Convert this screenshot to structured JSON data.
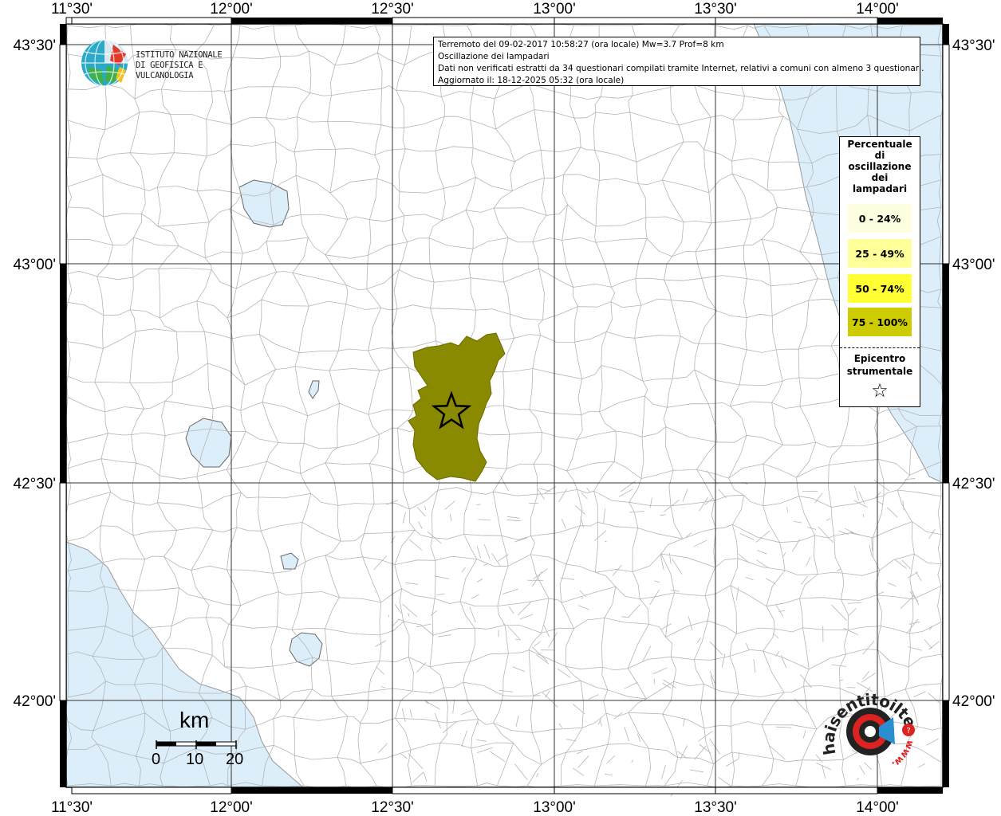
{
  "info": {
    "line1": "Terremoto del 09-02-2017 10:58:27 (ora locale) Mw=3.7 Prof=8 km",
    "line2": "Oscillazione dei lampadari",
    "line3": "Dati non verificati estratti da 34 questionari compilati tramite Internet, relativi a comuni con almeno 3 questionari.",
    "line4": "Aggiornato il: 18-12-2025 05:32 (ora locale)"
  },
  "axes": {
    "longitude_labels": [
      "11°30'",
      "12°00'",
      "12°30'",
      "13°00'",
      "13°30'",
      "14°00'"
    ],
    "latitude_labels": [
      "43°30'",
      "43°00'",
      "42°30'",
      "42°00'"
    ]
  },
  "legend": {
    "title_lines": [
      "Percentuale",
      "di",
      "oscillazione",
      "dei",
      "lampadari"
    ],
    "classes": [
      {
        "label": "0 - 24%",
        "color": "#fefee0"
      },
      {
        "label": "25 - 49%",
        "color": "#ffff99"
      },
      {
        "label": "50 - 74%",
        "color": "#ffff33"
      },
      {
        "label": "75 - 100%",
        "color": "#cccc00"
      }
    ],
    "epicenter_label_lines": [
      "Epicentro",
      "strumentale"
    ],
    "epicenter_symbol": "☆"
  },
  "logos": {
    "ingv_lines": [
      "ISTITUTO NAZIONALE",
      "DI GEOFISICA E VULCANOLOGIA"
    ],
    "hst_text": "haisentitoilterremoto.it",
    "hst_www": "www."
  },
  "scale_bar": {
    "unit": "km",
    "ticks": [
      "0",
      "10",
      "20"
    ]
  },
  "colors": {
    "sea": "#dceefa",
    "affected_municipality": "#8a8a00",
    "boundary": "#b0b0b0",
    "frame": "#000000"
  }
}
